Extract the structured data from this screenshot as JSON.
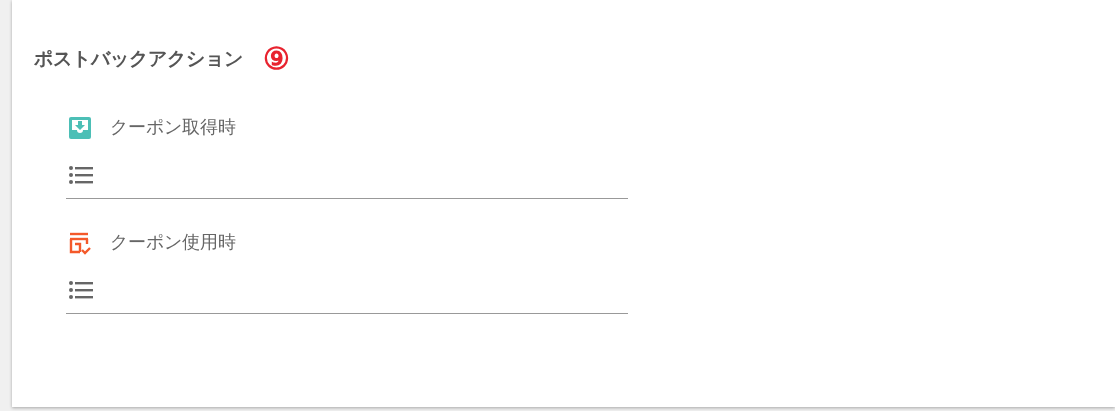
{
  "section": {
    "title": "ポストバックアクション",
    "badge": "⑨"
  },
  "actions": [
    {
      "kind": "acquire",
      "label": "クーポン取得時"
    },
    {
      "kind": "use",
      "label": "クーポン使用時"
    }
  ]
}
